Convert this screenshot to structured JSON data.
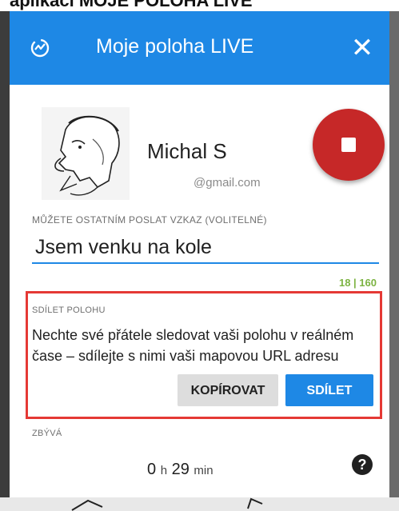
{
  "background": {
    "top_heading": "aplikaci  MOJE POLOHA LIVE"
  },
  "dialog": {
    "title": "Moje poloha LIVE",
    "close_icon": "close-icon",
    "app_icon": "live-location-icon"
  },
  "user": {
    "name": "Michal S",
    "email": "@gmail.com",
    "avatar": "caricature-avatar"
  },
  "stop_button": {
    "icon": "stop-icon",
    "color": "#c62828"
  },
  "message": {
    "label": "MŮŽETE OSTATNÍM POSLAT VZKAZ (VOLITELNÉ)",
    "value": "Jsem venku na kole",
    "counter": "18 | 160"
  },
  "share": {
    "title": "SDÍLET POLOHU",
    "description": "Nechte své přátele sledovat vaši polohu v reálném čase – sdílejte s nimi vaši mapovou URL adresu",
    "copy_label": "KOPÍROVAT",
    "share_label": "SDÍLET"
  },
  "remaining": {
    "label": "ZBÝVÁ",
    "hours": "0",
    "hours_unit": "h",
    "minutes": "29",
    "minutes_unit": "min"
  },
  "help_icon": "?",
  "colors": {
    "accent": "#1e88e5",
    "stop": "#c62828",
    "highlight_border": "#e53935",
    "counter": "#7cb342"
  }
}
